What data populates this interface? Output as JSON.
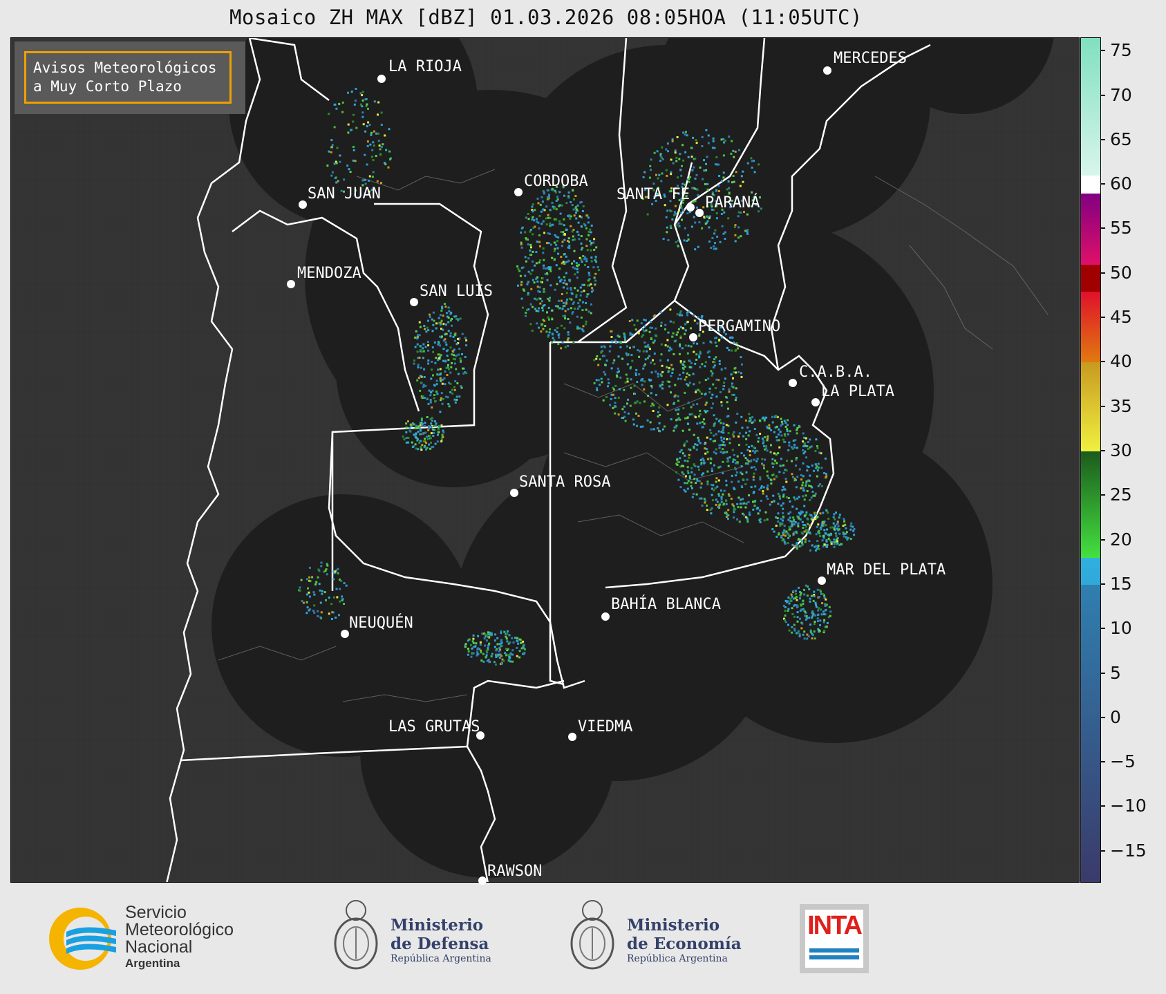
{
  "title": "Mosaico ZH MAX [dBZ] 01.03.2026 08:05HOA (11:05UTC)",
  "avisos_label": "Avisos Meteorológicos\na Muy Corto Plazo",
  "cities": [
    {
      "name": "LA RIOJA"
    },
    {
      "name": "MERCEDES"
    },
    {
      "name": "CORDOBA"
    },
    {
      "name": "SAN JUAN"
    },
    {
      "name": "SANTA FE"
    },
    {
      "name": "PARANÁ"
    },
    {
      "name": "MENDOZA"
    },
    {
      "name": "SAN LUIS"
    },
    {
      "name": "PERGAMINO"
    },
    {
      "name": "C.A.B.A."
    },
    {
      "name": "LA PLATA"
    },
    {
      "name": "SANTA ROSA"
    },
    {
      "name": "MAR DEL PLATA"
    },
    {
      "name": "BAHÍA BLANCA"
    },
    {
      "name": "NEUQUÉN"
    },
    {
      "name": "LAS GRUTAS"
    },
    {
      "name": "VIEDMA"
    },
    {
      "name": "RAWSON"
    }
  ],
  "colorbar": {
    "unit": "dBZ",
    "ticks": [
      "75",
      "70",
      "65",
      "60",
      "55",
      "50",
      "45",
      "40",
      "35",
      "30",
      "25",
      "20",
      "15",
      "10",
      "5",
      "0",
      "−5",
      "−10",
      "−15"
    ],
    "range": [
      -18.6,
      76.5
    ],
    "stops": [
      {
        "from": -18.6,
        "to": 15,
        "color_low": "#3a3a6a",
        "color_high": "#2f7fb0"
      },
      {
        "from": 15,
        "to": 18,
        "color_low": "#30a8d8",
        "color_high": "#30b0e0"
      },
      {
        "from": 18,
        "to": 30,
        "color_low": "#44e040",
        "color_high": "#1c5a1c"
      },
      {
        "from": 30,
        "to": 40,
        "color_low": "#f0f040",
        "color_high": "#c89a20"
      },
      {
        "from": 40,
        "to": 48,
        "color_low": "#e07a10",
        "color_high": "#e0102a"
      },
      {
        "from": 48,
        "to": 51,
        "color_low": "#a00000",
        "color_high": "#a00000"
      },
      {
        "from": 51,
        "to": 59,
        "color_low": "#e0106a",
        "color_high": "#800080"
      },
      {
        "from": 59,
        "to": 61,
        "color_low": "#ffffff",
        "color_high": "#ffffff"
      },
      {
        "from": 61,
        "to": 76.5,
        "color_low": "#d8f5ec",
        "color_high": "#80e0c0"
      }
    ]
  },
  "footer": {
    "smn_line1": "Servicio",
    "smn_line2": "Meteorológico",
    "smn_line3": "Nacional",
    "smn_line4": "Argentina",
    "defensa_line1": "Ministerio",
    "defensa_line2": "de Defensa",
    "defensa_line3": "República Argentina",
    "economia_line1": "Ministerio",
    "economia_line2": "de Economía",
    "economia_line3": "República Argentina",
    "inta": "INTA"
  },
  "colors": {
    "radar_coverage": "#1e1e1e",
    "background": "#333333",
    "border_white": "#ffffff",
    "avisos_border": "#f0a000",
    "smn_yellow": "#f5b400",
    "smn_blue": "#1aa0e0",
    "inta_red": "#e0201a",
    "inta_blue": "#2080c0"
  }
}
